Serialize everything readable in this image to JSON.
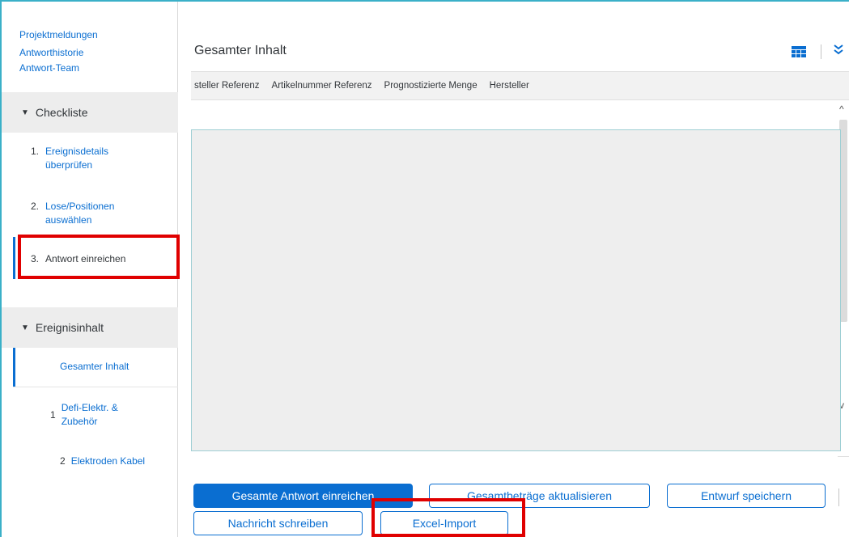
{
  "sidebar": {
    "links": [
      "Projektmeldungen",
      "Antworthistorie",
      "Antwort-Team"
    ],
    "checklist": {
      "title": "Checkliste",
      "steps": [
        {
          "num": "1.",
          "label": "Ereignisdetails überprüfen"
        },
        {
          "num": "2.",
          "label": "Lose/Positionen auswählen"
        },
        {
          "num": "3.",
          "label": "Antwort einreichen"
        }
      ]
    },
    "event_content": {
      "title": "Ereignisinhalt",
      "items": [
        {
          "num": "",
          "label": "Gesamter Inhalt"
        },
        {
          "num": "1",
          "label": "Defi-Elektr. & Zubehör"
        },
        {
          "num": "2",
          "label": "Elektroden Kabel"
        }
      ]
    }
  },
  "main": {
    "title": "Gesamter Inhalt",
    "columns": [
      "steller Referenz",
      "Artikelnummer Referenz",
      "Prognostizierte Menge",
      "Hersteller"
    ]
  },
  "buttons": {
    "submit": "Gesamte Antwort einreichen",
    "update_totals": "Gesamtbeträge aktualisieren",
    "save_draft": "Entwurf speichern",
    "write_message": "Nachricht schreiben",
    "excel_import": "Excel-Import"
  },
  "icons": {
    "table_settings": "table-icon",
    "expand": "chevron-double-down-icon",
    "collapse_triangle": "triangle-down-icon"
  },
  "colors": {
    "accent": "#0a6ed1",
    "highlight": "#e00000",
    "frame": "#3ab0c8"
  }
}
